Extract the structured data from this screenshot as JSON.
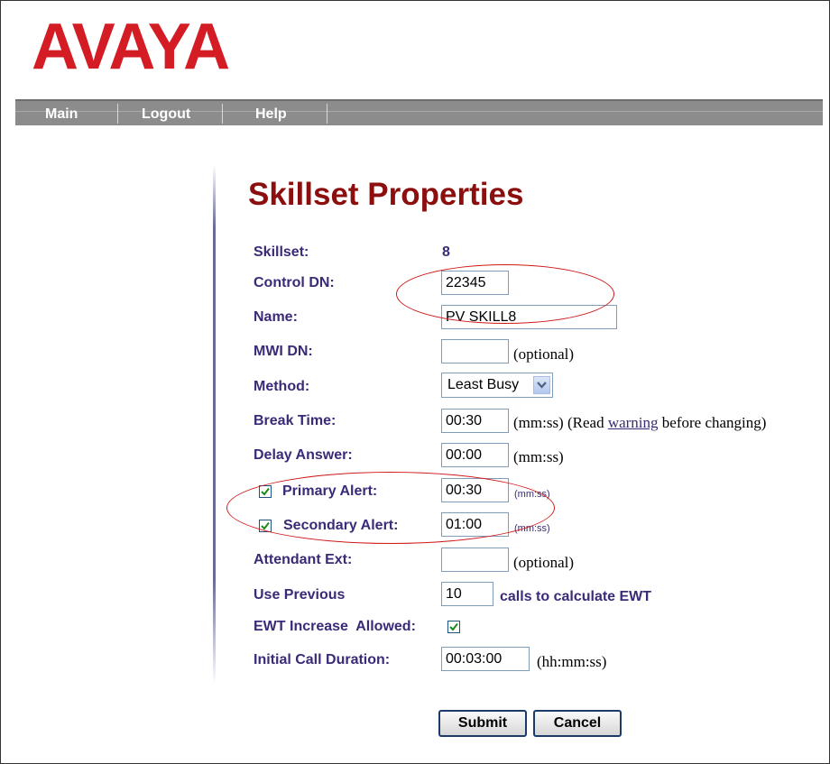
{
  "brand": {
    "logo_text": "AVAYA",
    "logo_color": "#d41c24"
  },
  "nav": {
    "items": [
      "Main",
      "Logout",
      "Help"
    ]
  },
  "page": {
    "title": "Skillset Properties"
  },
  "form": {
    "skillset": {
      "label": "Skillset:",
      "value": "8"
    },
    "control_dn": {
      "label": "Control DN:",
      "value": "22345"
    },
    "name": {
      "label": "Name:",
      "value": "PV SKILL8"
    },
    "mwi_dn": {
      "label": "MWI DN:",
      "value": "",
      "note": "(optional)"
    },
    "method": {
      "label": "Method:",
      "selected": "Least Busy"
    },
    "break_time": {
      "label": "Break Time:",
      "value": "00:30",
      "note_prefix": "(mm:ss) (Read ",
      "note_link": "warning",
      "note_suffix": " before changing)"
    },
    "delay_answer": {
      "label": "Delay Answer:",
      "value": "00:00",
      "note": "(mm:ss)"
    },
    "primary_alert": {
      "label": "Primary Alert:",
      "checked": true,
      "value": "00:30",
      "note": "(mm:ss)"
    },
    "secondary_alert": {
      "label": "Secondary Alert:",
      "checked": true,
      "value": "01:00",
      "note": "(mm:ss)"
    },
    "attendant_ext": {
      "label": "Attendant Ext:",
      "value": "",
      "note": "(optional)"
    },
    "use_previous": {
      "label": "Use Previous",
      "value": "10",
      "note": "calls to calculate EWT"
    },
    "ewt_increase": {
      "label": "EWT Increase  Allowed:",
      "checked": true
    },
    "initial_call_duration": {
      "label": "Initial Call Duration:",
      "value": "00:03:00",
      "note": "(hh:mm:ss)"
    }
  },
  "buttons": {
    "submit": "Submit",
    "cancel": "Cancel"
  }
}
